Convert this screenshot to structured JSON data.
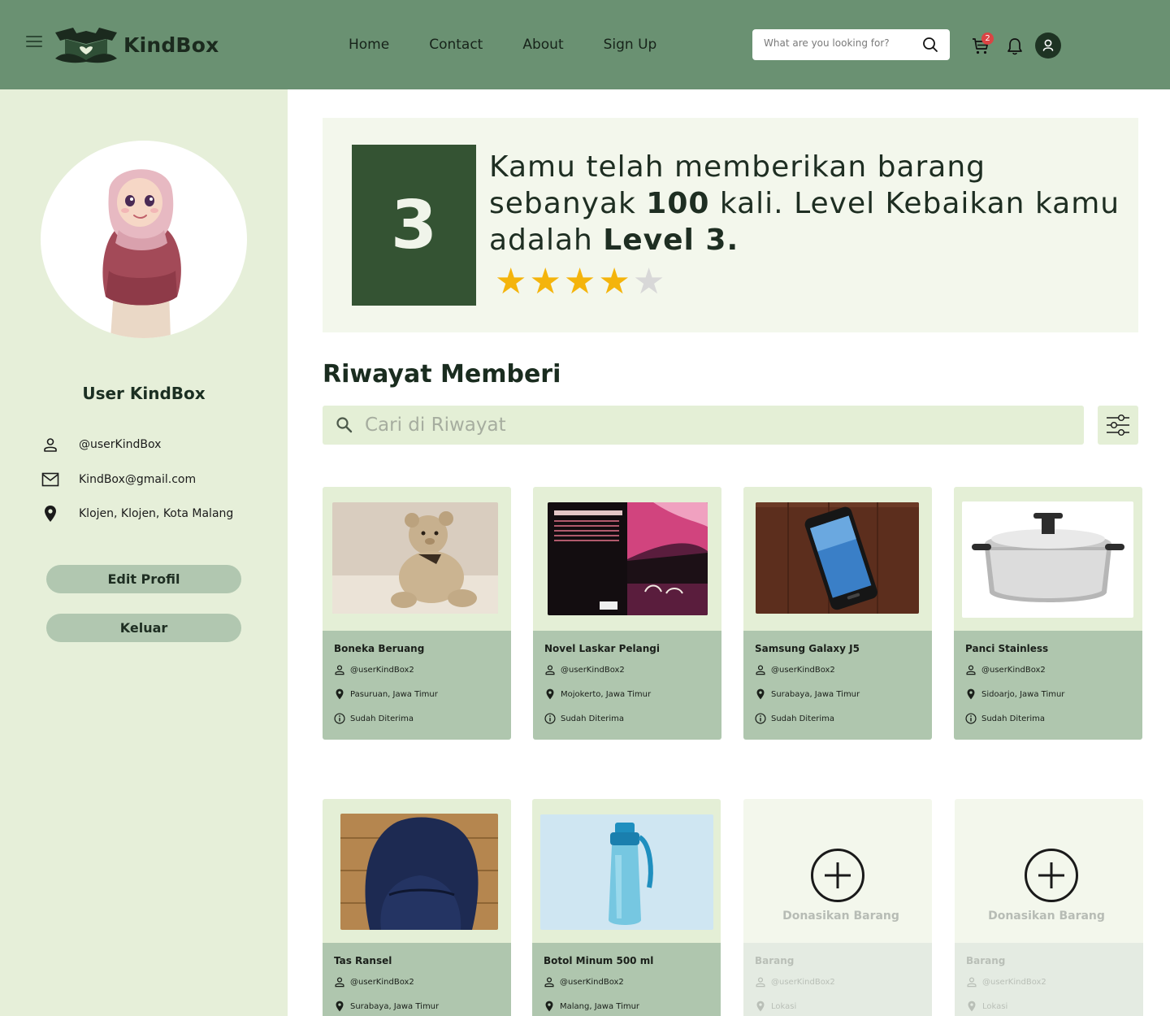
{
  "header": {
    "brand": "KindBox",
    "nav": [
      "Home",
      "Contact",
      "About",
      "Sign Up"
    ],
    "search_placeholder": "What are you looking for?",
    "cart_count": "2"
  },
  "profile": {
    "name": "User KindBox",
    "username": "@userKindBox",
    "email": "KindBox@gmail.com",
    "location": "Klojen, Klojen, Kota Malang",
    "edit_label": "Edit Profil",
    "logout_label": "Keluar"
  },
  "level": {
    "number": "3",
    "text_before_count": "Kamu telah memberikan barang sebanyak ",
    "count": "100",
    "text_after_count": " kali. Level Kebaikan kamu adalah ",
    "level_label": "Level 3.",
    "rating": 4,
    "max_rating": 5
  },
  "history": {
    "title": "Riwayat Memberi",
    "search_placeholder": "Cari di Riwayat",
    "items": [
      {
        "title": "Boneka Beruang",
        "user": "@userKindBox2",
        "location": "Pasuruan, Jawa Timur",
        "status": "Sudah Diterima",
        "image": "teddy-bear"
      },
      {
        "title": "Novel Laskar Pelangi",
        "user": "@userKindBox2",
        "location": "Mojokerto, Jawa Timur",
        "status": "Sudah Diterima",
        "image": "book-cover"
      },
      {
        "title": "Samsung  Galaxy J5",
        "user": "@userKindBox2",
        "location": "Surabaya, Jawa Timur",
        "status": "Sudah Diterima",
        "image": "smartphone"
      },
      {
        "title": "Panci Stainless",
        "user": "@userKindBox2",
        "location": "Sidoarjo, Jawa Timur",
        "status": "Sudah Diterima",
        "image": "cooking-pot"
      },
      {
        "title": "Tas Ransel",
        "user": "@userKindBox2",
        "location": "Surabaya, Jawa Timur",
        "image": "backpack"
      },
      {
        "title": "Botol Minum 500 ml",
        "user": "@userKindBox2",
        "location": "Malang, Jawa Timur",
        "image": "water-bottle"
      }
    ],
    "placeholders": [
      {
        "label": "Donasikan Barang",
        "title": "Barang",
        "user": "@userKindBox2",
        "location": "Lokasi"
      },
      {
        "label": "Donasikan Barang",
        "title": "Barang",
        "user": "@userKindBox2",
        "location": "Lokasi"
      }
    ]
  },
  "colors": {
    "header": "#6a9172",
    "sidebar": "#e6efd9",
    "level_box": "#345333",
    "card_info": "#afc6ae",
    "star_on": "#f4b40c",
    "star_off": "#d8d8d8",
    "badge": "#db4444"
  }
}
